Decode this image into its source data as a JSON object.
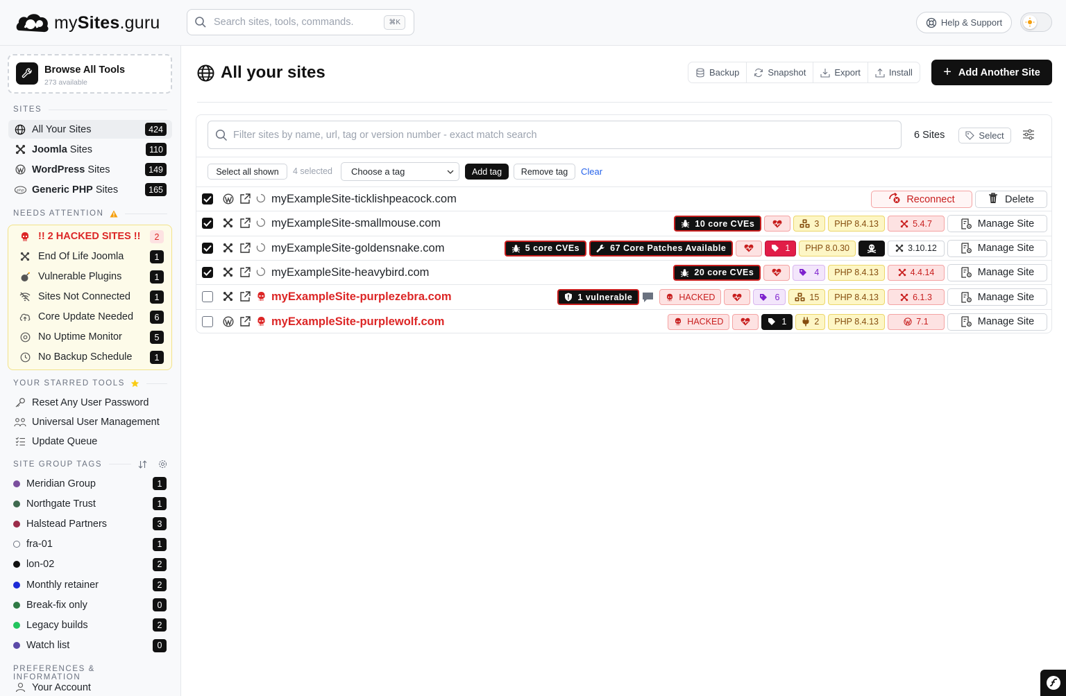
{
  "brand": {
    "name_light": "my",
    "name_bold": "Sites",
    "name_suffix": ".guru"
  },
  "search": {
    "placeholder": "Search sites, tools, commands.",
    "shortcut": "⌘K"
  },
  "header": {
    "help_label": "Help & Support"
  },
  "sidebar": {
    "browse": {
      "title": "Browse All Tools",
      "subtitle": "273 available"
    },
    "sites_heading": "SITES",
    "sites": [
      {
        "label_bold": "",
        "label": "All Your Sites",
        "count": "424"
      },
      {
        "label_bold": "Joomla",
        "label": " Sites",
        "count": "110"
      },
      {
        "label_bold": "WordPress",
        "label": " Sites",
        "count": "149"
      },
      {
        "label_bold": "Generic PHP",
        "label": " Sites",
        "count": "165"
      }
    ],
    "attention_heading": "NEEDS ATTENTION",
    "attention": [
      {
        "label": "!! 2 HACKED SITES !!",
        "count": "2"
      },
      {
        "label": "End Of Life Joomla",
        "count": "1"
      },
      {
        "label": "Vulnerable Plugins",
        "count": "1"
      },
      {
        "label": "Sites Not Connected",
        "count": "1"
      },
      {
        "label": "Core Update Needed",
        "count": "6"
      },
      {
        "label": "No Uptime Monitor",
        "count": "5"
      },
      {
        "label": "No Backup Schedule",
        "count": "1"
      }
    ],
    "starred_heading": "YOUR STARRED TOOLS",
    "starred": [
      {
        "label": "Reset Any User Password"
      },
      {
        "label": "Universal User Management"
      },
      {
        "label": "Update Queue"
      }
    ],
    "tags_heading": "SITE GROUP TAGS",
    "tags": [
      {
        "label": "Meridian Group",
        "count": "1",
        "color": "#7b4f9e"
      },
      {
        "label": "Northgate Trust",
        "count": "1",
        "color": "#3f6a4f"
      },
      {
        "label": "Halstead Partners",
        "count": "3",
        "color": "#9b2c4a"
      },
      {
        "label": "fra-01",
        "count": "1",
        "color": "#ffffff"
      },
      {
        "label": "lon-02",
        "count": "2",
        "color": "#111111"
      },
      {
        "label": "Monthly retainer",
        "count": "2",
        "color": "#1d2bd8"
      },
      {
        "label": "Break-fix only",
        "count": "0",
        "color": "#2f7a45"
      },
      {
        "label": "Legacy builds",
        "count": "2",
        "color": "#22c55e"
      },
      {
        "label": "Watch list",
        "count": "0",
        "color": "#5b4aa8"
      }
    ],
    "prefs_heading": "PREFERENCES & INFORMATION",
    "account_label": "Your Account"
  },
  "main": {
    "title": "All your sites",
    "toolbar": {
      "backup": "Backup",
      "snapshot": "Snapshot",
      "export": "Export",
      "install": "Install"
    },
    "add_site_label": "Add Another Site",
    "filter_placeholder": "Filter sites by name, url, tag or version number - exact match search",
    "sites_count": "6 Sites",
    "select_label": "Select",
    "bulk": {
      "select_all": "Select all shown",
      "selected": "4 selected",
      "tag_select_value": "Choose a tag",
      "add_tag": "Add tag",
      "remove_tag": "Remove tag",
      "clear": "Clear"
    },
    "rows": [
      {
        "name": "myExampleSite-ticklishpeacock.com",
        "checked": true,
        "cms": "wordpress",
        "reconnect_label": "Reconnect",
        "delete_label": "Delete"
      },
      {
        "name": "myExampleSite-smallmouse.com",
        "checked": true,
        "cms": "joomla",
        "cves": "10 core CVEs",
        "plugins_count": "3",
        "php": "PHP 8.4.13",
        "version": "5.4.7",
        "manage_label": "Manage Site"
      },
      {
        "name": "myExampleSite-goldensnake.com",
        "checked": true,
        "cms": "joomla",
        "cves": "5 core CVEs",
        "patches": "67 Core Patches Available",
        "tags_count": "1",
        "php": "PHP 8.0.30",
        "version": "3.10.12",
        "manage_label": "Manage Site"
      },
      {
        "name": "myExampleSite-heavybird.com",
        "checked": true,
        "cms": "joomla",
        "cves": "20 core CVEs",
        "tags_count": "4",
        "php": "PHP 8.4.13",
        "version": "4.4.14",
        "manage_label": "Manage Site"
      },
      {
        "name": "myExampleSite-purplezebra.com",
        "checked": false,
        "cms": "joomla",
        "vulnerable": "1 vulnerable",
        "hacked_label": "HACKED",
        "tags_count": "6",
        "plugins_count": "15",
        "php": "PHP 8.4.13",
        "version": "6.1.3",
        "manage_label": "Manage Site"
      },
      {
        "name": "myExampleSite-purplewolf.com",
        "checked": false,
        "cms": "wordpress",
        "hacked_label": "HACKED",
        "tags_count": "1",
        "plugins_count": "2",
        "php": "PHP 8.4.13",
        "version": "7.1",
        "manage_label": "Manage Site"
      }
    ]
  }
}
